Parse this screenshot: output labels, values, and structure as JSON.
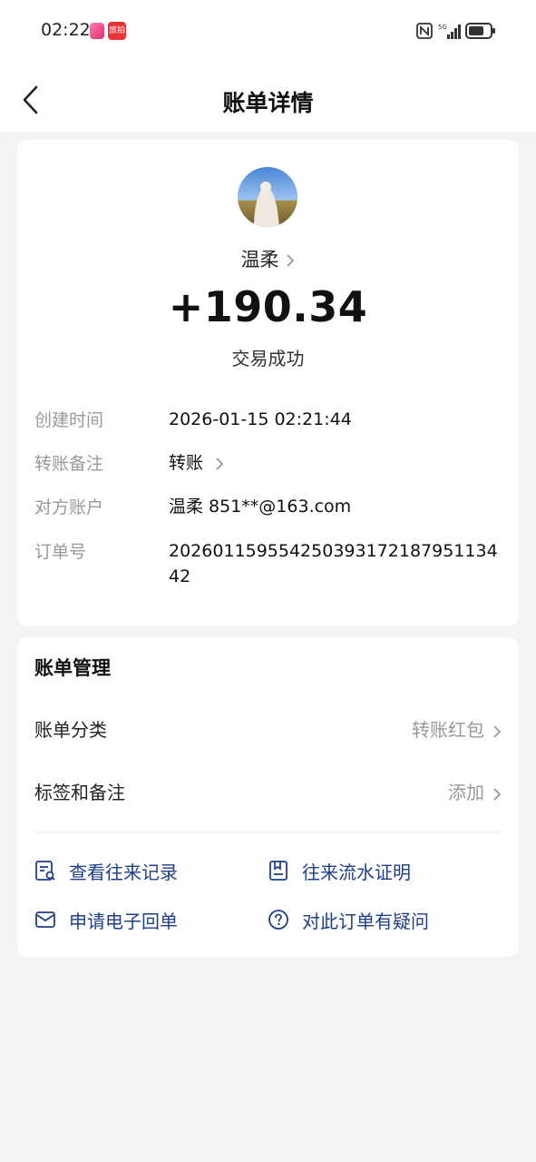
{
  "status_bar": {
    "time": "02:22",
    "app_icon_2_text": "旅拍",
    "network": "5G"
  },
  "header": {
    "title": "账单详情"
  },
  "transaction": {
    "name": "温柔",
    "amount": "+190.34",
    "status": "交易成功"
  },
  "details": [
    {
      "label": "创建时间",
      "value": "2026-01-15 02:21:44"
    },
    {
      "label": "转账备注",
      "value": "转账"
    },
    {
      "label": "对方账户",
      "value": "温柔 851**@163.com"
    },
    {
      "label": "订单号",
      "value": "20260115955425039317218795113442"
    }
  ],
  "management": {
    "title": "账单管理",
    "rows": [
      {
        "label": "账单分类",
        "value": "转账红包"
      },
      {
        "label": "标签和备注",
        "value": "添加"
      }
    ],
    "links": [
      {
        "label": "查看往来记录",
        "icon": "records-icon"
      },
      {
        "label": "往来流水证明",
        "icon": "statement-icon"
      },
      {
        "label": "申请电子回单",
        "icon": "mail-icon"
      },
      {
        "label": "对此订单有疑问",
        "icon": "question-icon"
      }
    ]
  },
  "colors": {
    "link": "#1e3f8a",
    "background": "#f4f4f4",
    "label_gray": "#999999"
  }
}
